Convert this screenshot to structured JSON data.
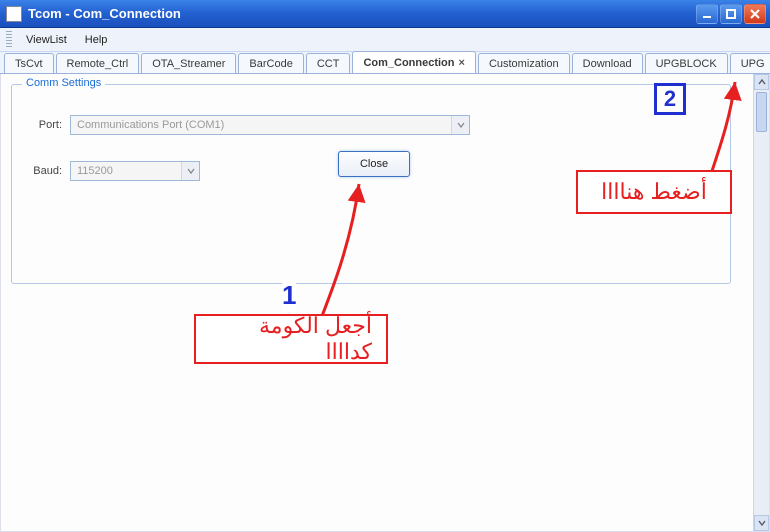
{
  "window": {
    "title": "Tcom - Com_Connection"
  },
  "menu": {
    "viewlist": "ViewList",
    "help": "Help"
  },
  "tabs": [
    {
      "label": "TsCvt"
    },
    {
      "label": "Remote_Ctrl"
    },
    {
      "label": "OTA_Streamer"
    },
    {
      "label": "BarCode"
    },
    {
      "label": "CCT"
    },
    {
      "label": "Com_Connection",
      "active": true,
      "closable": true
    },
    {
      "label": "Customization"
    },
    {
      "label": "Download"
    },
    {
      "label": "UPGBLOCK"
    },
    {
      "label": "UPG"
    }
  ],
  "group": {
    "title": "Comm Settings",
    "port_label": "Port:",
    "port_value": "Communications Port (COM1)",
    "baud_label": "Baud:",
    "baud_value": "115200",
    "close_btn": "Close"
  },
  "annotations": {
    "num1": "1",
    "num2": "2",
    "text1": "أجعل الكومة كداااا",
    "text2": "أضغط هناااا"
  }
}
